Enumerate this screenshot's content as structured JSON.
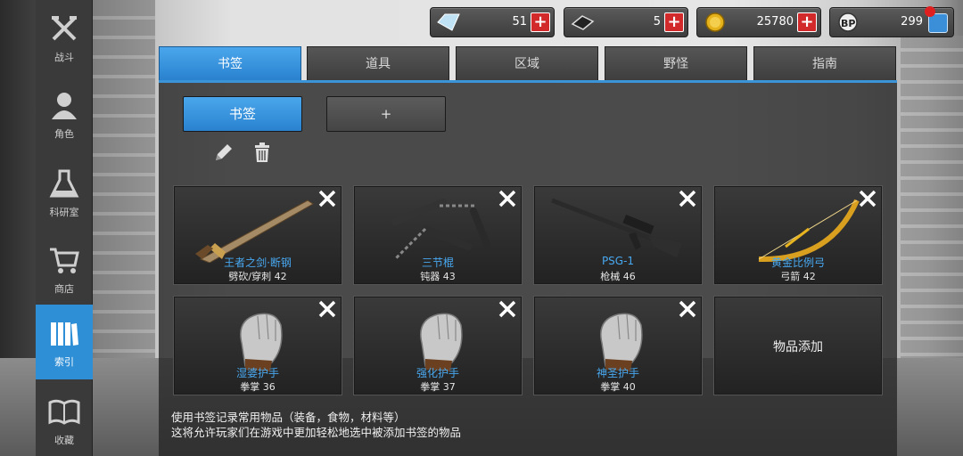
{
  "currencies": [
    {
      "icon": "diamond-icon",
      "value": "51",
      "plus": "+"
    },
    {
      "icon": "ticket-icon",
      "value": "5",
      "plus": "+"
    },
    {
      "icon": "gold-coin-icon",
      "value": "25780",
      "plus": "+"
    },
    {
      "icon": "bp-icon",
      "value": "299",
      "icon_text": "BP"
    }
  ],
  "sidebar": {
    "items": [
      {
        "label": "战斗",
        "icon": "crossed-weapons-icon"
      },
      {
        "label": "角色",
        "icon": "character-icon"
      },
      {
        "label": "科研室",
        "icon": "flask-icon"
      },
      {
        "label": "商店",
        "icon": "cart-icon"
      },
      {
        "label": "索引",
        "icon": "books-icon",
        "active": true
      },
      {
        "label": "收藏",
        "icon": "open-book-icon"
      }
    ]
  },
  "tabs": [
    {
      "label": "书签",
      "active": true
    },
    {
      "label": "道具"
    },
    {
      "label": "区域"
    },
    {
      "label": "野怪"
    },
    {
      "label": "指南"
    }
  ],
  "bookmark": {
    "active_label": "书签",
    "add_label": "+"
  },
  "items": [
    {
      "name": "王者之剑·断钢",
      "type": "劈砍/穿刺 42",
      "icon": "sword-icon"
    },
    {
      "name": "三节棍",
      "type": "钝器 43",
      "icon": "nunchaku-icon"
    },
    {
      "name": "PSG-1",
      "type": "枪械 46",
      "icon": "sniper-rifle-icon"
    },
    {
      "name": "黄金比例弓",
      "type": "弓箭 42",
      "icon": "golden-bow-icon"
    },
    {
      "name": "湿婆护手",
      "type": "拳掌 36",
      "icon": "gauntlet-icon"
    },
    {
      "name": "强化护手",
      "type": "拳掌 37",
      "icon": "gauntlet-icon"
    },
    {
      "name": "神圣护手",
      "type": "拳掌 40",
      "icon": "gauntlet-icon"
    }
  ],
  "empty_slot_label": "物品添加",
  "hint": {
    "line1": "使用书签记录常用物品（装备，食物，材料等）",
    "line2": "这将允许玩家们在游戏中更加轻松地选中被添加书签的物品"
  }
}
